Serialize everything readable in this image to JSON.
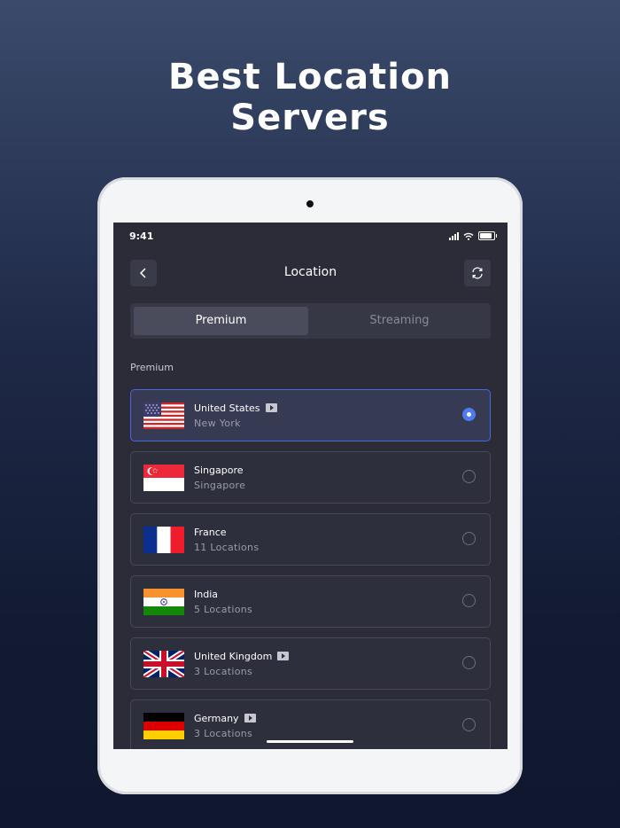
{
  "headline": {
    "line1": "Best Location",
    "line2": "Servers"
  },
  "status_bar": {
    "time": "9:41"
  },
  "nav": {
    "title": "Location",
    "back_icon": "chevron-left-icon",
    "refresh_icon": "refresh-icon"
  },
  "tabs": [
    {
      "label": "Premium",
      "selected": true
    },
    {
      "label": "Streaming",
      "selected": false
    }
  ],
  "section_label": "Premium",
  "servers": [
    {
      "country": "United States",
      "detail": "New York",
      "streaming": true,
      "selected": true,
      "flag": "us-flag-icon"
    },
    {
      "country": "Singapore",
      "detail": "Singapore",
      "streaming": false,
      "selected": false,
      "flag": "sg-flag-icon"
    },
    {
      "country": "France",
      "detail": "11 Locations",
      "streaming": false,
      "selected": false,
      "flag": "fr-flag-icon"
    },
    {
      "country": "India",
      "detail": "5 Locations",
      "streaming": false,
      "selected": false,
      "flag": "in-flag-icon"
    },
    {
      "country": "United Kingdom",
      "detail": "3 Locations",
      "streaming": true,
      "selected": false,
      "flag": "uk-flag-icon"
    },
    {
      "country": "Germany",
      "detail": "3 Locations",
      "streaming": true,
      "selected": false,
      "flag": "de-flag-icon"
    }
  ],
  "colors": {
    "accent": "#4f7af0",
    "selected_border": "#4767e6",
    "screen_bg": "#2b2c38"
  }
}
